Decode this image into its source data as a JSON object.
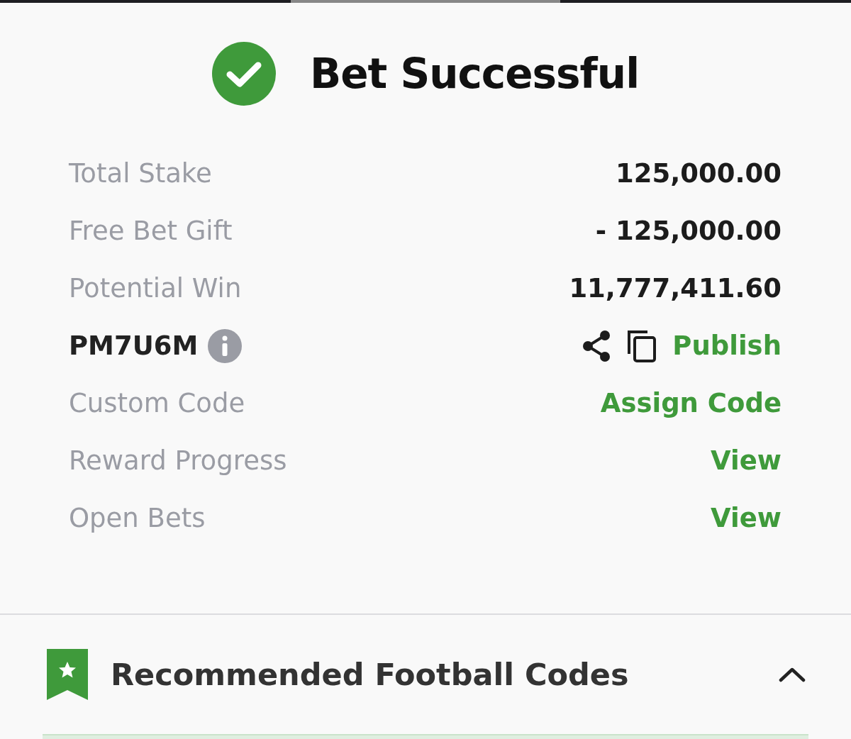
{
  "title": "Bet Successful",
  "rows": [
    {
      "kind": "plain",
      "label": "Total Stake",
      "value": "125,000.00"
    },
    {
      "kind": "plain",
      "label": "Free Bet Gift",
      "value": "- 125,000.00"
    },
    {
      "kind": "plain",
      "label": "Potential Win",
      "value": "11,777,411.60"
    },
    {
      "kind": "code",
      "label": "PM7U6M",
      "value": "Publish"
    },
    {
      "kind": "link",
      "label": "Custom Code",
      "value": "Assign Code"
    },
    {
      "kind": "link",
      "label": "Reward Progress",
      "value": "View"
    },
    {
      "kind": "link",
      "label": "Open Bets",
      "value": "View"
    }
  ],
  "section": {
    "title": "Recommended Football Codes",
    "expanded": true
  }
}
